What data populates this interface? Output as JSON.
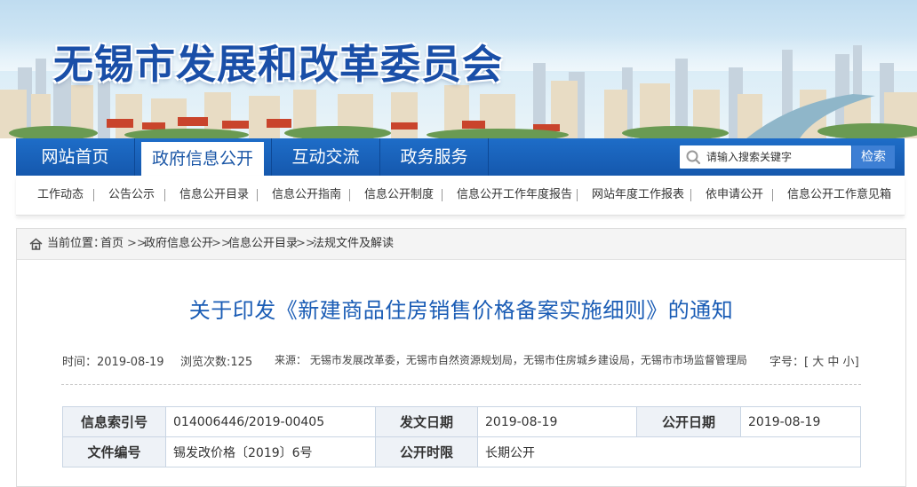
{
  "site": {
    "title": "无锡市发展和改革委员会"
  },
  "main_nav": {
    "items": [
      "网站首页",
      "政府信息公开",
      "互动交流",
      "政务服务"
    ],
    "active_index": 1
  },
  "search": {
    "placeholder": "请输入搜索关键字",
    "button": "检索"
  },
  "sub_nav": [
    "工作动态",
    "公告公示",
    "信息公开目录",
    "信息公开指南",
    "信息公开制度",
    "信息公开工作年度报告",
    "网站年度工作报表",
    "依申请公开",
    "信息公开工作意见箱"
  ],
  "breadcrumb": {
    "label": "当前位置：",
    "items": [
      "首页",
      "政府信息公开",
      "信息公开目录",
      "法规文件及解读"
    ],
    "separator": ">>"
  },
  "article": {
    "title": "关于印发《新建商品住房销售价格备案实施细则》的通知",
    "time": "时间：2019-08-19",
    "views": "浏览次数:125",
    "source": "来源： 无锡市发展改革委，无锡市自然资源规划局，无锡市住房城乡建设局，无锡市市场监督管理局",
    "font_size": {
      "label": "字号：",
      "open": "[",
      "large": "大",
      "medium": "中",
      "small": "小",
      "close": "]"
    }
  },
  "info_table": {
    "row1": {
      "k1": "信息索引号",
      "v1": "014006446/2019-00405",
      "k2": "发文日期",
      "v2": "2019-08-19",
      "k3": "公开日期",
      "v3": "2019-08-19"
    },
    "row2": {
      "k1": "文件编号",
      "v1": "锡发改价格〔2019〕6号",
      "k2": "公开时限",
      "v2": "长期公开"
    }
  },
  "colors": {
    "brand_blue": "#1558ad",
    "title_blue": "#1a5cb5",
    "header_text": "#1a4fa8"
  }
}
